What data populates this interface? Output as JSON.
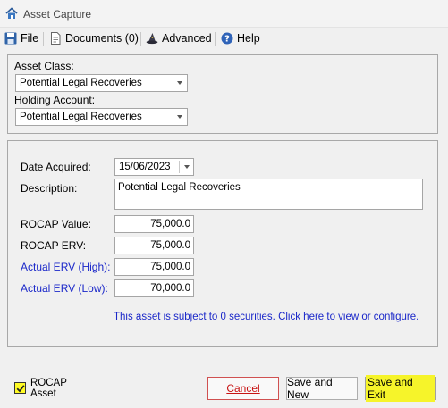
{
  "window": {
    "title": "Asset Capture",
    "icon": "house-icon"
  },
  "menu": {
    "file": {
      "label": "File",
      "icon": "save-disk-icon"
    },
    "documents": {
      "label": "Documents (0)",
      "icon": "document-icon"
    },
    "advanced": {
      "label": "Advanced",
      "icon": "wizard-hat-icon"
    },
    "help": {
      "label": "Help",
      "icon": "help-icon"
    }
  },
  "asset": {
    "class_label": "Asset Class:",
    "class_value": "Potential Legal Recoveries",
    "holding_label": "Holding Account:",
    "holding_value": "Potential Legal Recoveries"
  },
  "details": {
    "date_label": "Date Acquired:",
    "date_value": "15/06/2023",
    "description_label": "Description:",
    "description_value": "Potential Legal Recoveries",
    "rocap_value_label": "ROCAP Value:",
    "rocap_value": "75,000.0",
    "rocap_erv_label": "ROCAP ERV:",
    "rocap_erv": "75,000.0",
    "actual_high_label": "Actual ERV (High):",
    "actual_high": "75,000.0",
    "actual_low_label": "Actual ERV (Low):",
    "actual_low": "70,000.0",
    "securities_link": "This asset is subject to 0 securities.  Click here to view or configure."
  },
  "footer": {
    "rocap_checkbox_checked": true,
    "rocap_line1": "ROCAP",
    "rocap_line2": "Asset",
    "cancel": "Cancel",
    "save_new": "Save and New",
    "save_exit": "Save and Exit"
  },
  "colors": {
    "link": "#1a27c9",
    "highlight": "#f6f42a",
    "cancel": "#c81414"
  }
}
